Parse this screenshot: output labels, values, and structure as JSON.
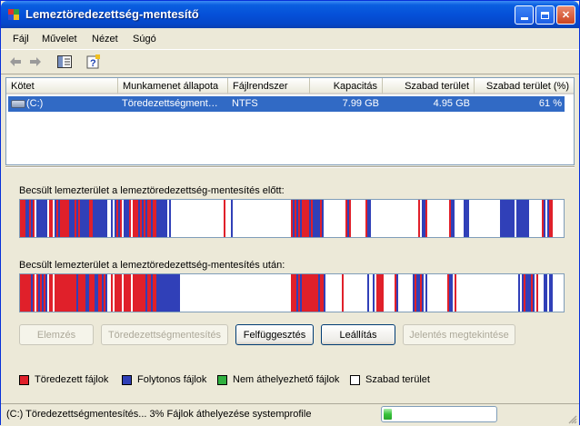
{
  "window": {
    "title": "Lemeztöredezettség-mentesítő"
  },
  "menu": [
    "Fájl",
    "Művelet",
    "Nézet",
    "Súgó"
  ],
  "toolbar": {
    "back_icon": "arrow-left-icon",
    "forward_icon": "arrow-right-icon",
    "view_icon": "console-tree-icon",
    "help_icon": "help-icon"
  },
  "columns": [
    "Kötet",
    "Munkamenet állapota",
    "Fájlrendszer",
    "Kapacitás",
    "Szabad terület",
    "Szabad terület (%)"
  ],
  "volumes": [
    {
      "volume": "(C:)",
      "status": "Töredezettségment…",
      "filesystem": "NTFS",
      "capacity": "7.99 GB",
      "free": "4.95 GB",
      "free_pct": "61 %"
    }
  ],
  "captions": {
    "before": "Becsült lemezterület a lemeztöredezettség-mentesítés előtt:",
    "after": "Becsült lemezterület a lemeztöredezettség-mentesítés után:"
  },
  "buttons": {
    "analyze": "Elemzés",
    "defragment": "Töredezettségmentesítés",
    "pause": "Felfüggesztés",
    "stop": "Leállítás",
    "report": "Jelentés megtekintése"
  },
  "legend": [
    {
      "label": "Töredezett fájlok",
      "color": "#e0202a"
    },
    {
      "label": "Folytonos fájlok",
      "color": "#3040b8"
    },
    {
      "label": "Nem áthelyezhető fájlok",
      "color": "#30b040"
    },
    {
      "label": "Szabad terület",
      "color": "#ffffff"
    }
  ],
  "status": {
    "text": "(C:) Töredezettségmentesítés...  3%  Fájlok áthelyezése systemprofile",
    "progress_fraction": 0.03
  },
  "colors": {
    "fragmented": "#e0202a",
    "contiguous": "#3040b8",
    "free": "#ffffff",
    "title_bar": "#0550d8",
    "selection": "#316ac5"
  }
}
